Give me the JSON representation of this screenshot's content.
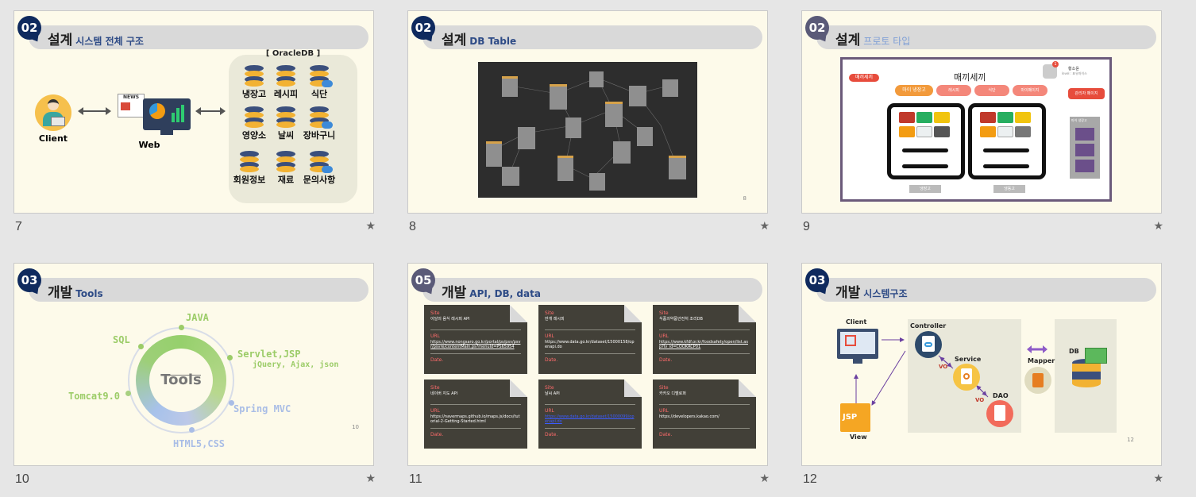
{
  "slides": [
    {
      "number": "7",
      "badge": "02",
      "title": "설계",
      "subtitle": "시스템 전체 구조",
      "client_label": "Client",
      "web_label": "Web",
      "news_label": "NEWS",
      "db_box_title": "[ OracleDB ]",
      "db_items": [
        "냉장고",
        "레시피",
        "식단",
        "영양소",
        "날씨",
        "장바구니",
        "회원정보",
        "재료",
        "문의사항"
      ]
    },
    {
      "number": "8",
      "badge": "02",
      "title": "설계",
      "subtitle": "DB Table",
      "page_number": "8"
    },
    {
      "number": "9",
      "badge": "02",
      "title": "설계",
      "subtitle": "프로토 타입",
      "proto": {
        "logo_label": "매끼세끼",
        "app_title": "매끼세끼",
        "user_name": "황소윤",
        "user_level": "level : 표유마이스",
        "notif_count": "1",
        "nav_tabs": [
          "마이 냉장고",
          "레시피",
          "식단",
          "마이페이지"
        ],
        "admin_button": "관리자 페이지",
        "side_header": "마이 냉장고",
        "bottom_buttons": [
          "냉장고",
          "냉동고"
        ]
      }
    },
    {
      "number": "10",
      "badge": "03",
      "title": "개발",
      "subtitle": "Tools",
      "center_label": "Tools",
      "tools": [
        "JAVA",
        "SQL",
        "Servlet,JSP",
        "jQuery, Ajax, json",
        "Tomcat9.0",
        "Spring MVC",
        "HTML5,CSS"
      ],
      "page_number": "10"
    },
    {
      "number": "11",
      "badge": "05",
      "title": "개발",
      "subtitle": "API, DB, data",
      "cards": [
        {
          "site_label": "Site",
          "site": "이달의 음식 레시피 API",
          "url_label": "URL",
          "url": "https://www.nongsaro.go.kr/portal/ps/psv/psvr/psvre/contentMain.ps?menuId=PS65954",
          "date_label": "Date."
        },
        {
          "site_label": "Site",
          "site": "만개 레시피",
          "url_label": "URL",
          "url": "https://www.data.go.kr/dataset/15000158/openapi.do",
          "date_label": "Date."
        },
        {
          "site_label": "Site",
          "site": "식품의약품안전처 조리DB",
          "url_label": "URL",
          "url": "https://www.kfdf.or.kr/foodsafety/open/list.asp?lv_id=COOKRCP01",
          "date_label": "Date."
        },
        {
          "site_label": "Site",
          "site": "네이버 지도 API",
          "url_label": "URL",
          "url": "https://navermaps.github.io/maps.js/docs/tutorial-2-Getting-Started.html",
          "date_label": "Date."
        },
        {
          "site_label": "Site",
          "site": "날씨 API",
          "url_label": "URL",
          "url": "https://www.data.go.kr/dataset/15000099/openapi.do",
          "date_label": "Date."
        },
        {
          "site_label": "Site",
          "site": "카카오 디벨로퍼",
          "url_label": "URL",
          "url": "https://developers.kakao.com/",
          "date_label": "Date."
        }
      ]
    },
    {
      "number": "12",
      "badge": "03",
      "title": "개발",
      "subtitle": "시스템구조",
      "client_label": "Client",
      "view_label": "View",
      "jsp_label": "JSP",
      "controller_label": "Controller",
      "service_label": "Service",
      "dao_label": "DAO",
      "mapper_label": "Mapper",
      "db_label": "DB",
      "vo_labels": [
        "VO",
        "VO"
      ],
      "page_number": "12"
    }
  ],
  "star_glyph": "★"
}
